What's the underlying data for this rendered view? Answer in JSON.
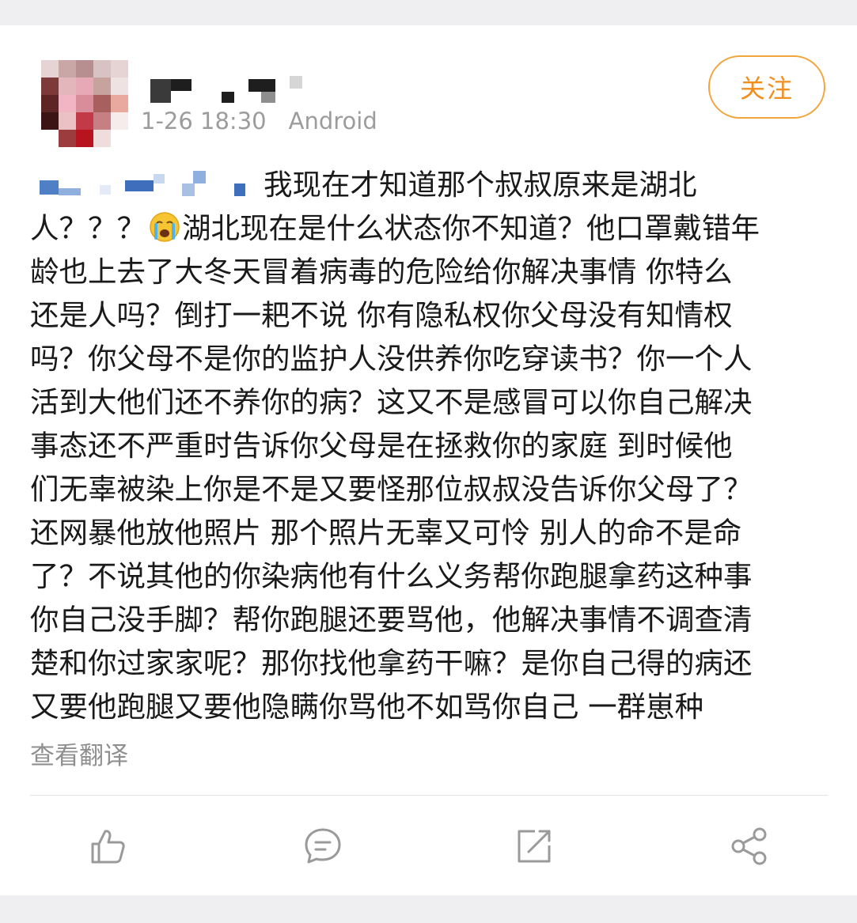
{
  "post": {
    "meta": {
      "time": "1-26 18:30",
      "device": "Android"
    },
    "follow_label": "关注",
    "lines": [
      "我现在才知道那个叔叔原来是湖北",
      "人？？？",
      "湖北现在是什么状态你不知道？他口罩戴错年",
      "龄也上去了大冬天冒着病毒的危险给你解决事情 你特么",
      "还是人吗？倒打一耙不说 你有隐私权你父母没有知情权",
      "吗？你父母不是你的监护人没供养你吃穿读书？你一个人",
      "活到大他们还不养你的病？这又不是感冒可以你自己解决",
      "事态还不严重时告诉你父母是在拯救你的家庭 到时候他",
      "们无辜被染上你是不是又要怪那位叔叔没告诉你父母了？",
      "还网暴他放他照片 那个照片无辜又可怜 别人的命不是命",
      "了？不说其他的你染病他有什么义务帮你跑腿拿药这种事",
      "你自己没手脚？帮你跑腿还要骂他，他解决事情不调查清",
      "楚和你过家家呢？那你找他拿药干嘛？是你自己得的病还",
      "又要他跑腿又要他隐瞒你骂他不如骂你自己 一群崽种"
    ],
    "translate_label": "查看翻译"
  },
  "icons": {
    "emoji": "crying-face-emoji",
    "like": "thumbs-up-icon",
    "comment": "comment-bubble-icon",
    "repost": "repost-arrow-icon",
    "share": "share-nodes-icon"
  },
  "colors": {
    "accent": "#f08e1e",
    "text": "#1a1a1a",
    "meta": "#9c9c9c",
    "icon": "#9a9a9a"
  }
}
